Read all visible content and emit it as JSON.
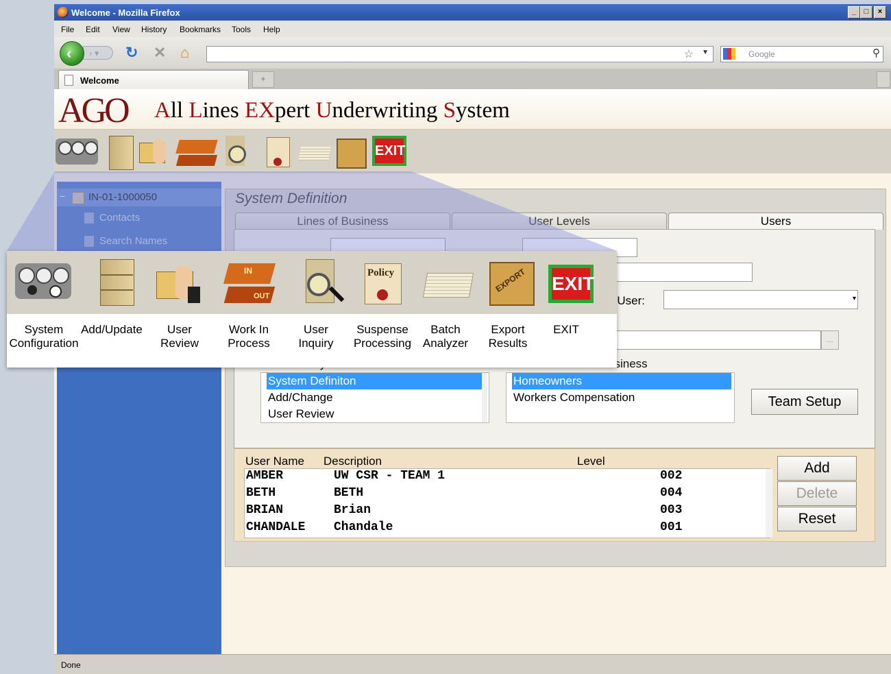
{
  "browser": {
    "window_title": "Welcome - Mozilla Firefox",
    "menu": [
      "File",
      "Edit",
      "View",
      "History",
      "Bookmarks",
      "Tools",
      "Help"
    ],
    "search_placeholder": "Google",
    "tab_title": "Welcome",
    "status": "Done"
  },
  "app": {
    "logo": "AGO",
    "title_parts": [
      {
        "cap": "A",
        "rest": "ll "
      },
      {
        "cap": "L",
        "rest": "ines "
      },
      {
        "cap": "EX",
        "rest": "pert "
      },
      {
        "cap": "U",
        "rest": "nderwriting "
      },
      {
        "cap": "S",
        "rest": "ystem"
      }
    ]
  },
  "toolbar": {
    "items": [
      {
        "line1": "System",
        "line2": "Configuration",
        "icon": "gauges-icon"
      },
      {
        "line1": "Add/Update",
        "line2": "",
        "icon": "file-cabinet-icon"
      },
      {
        "line1": "User",
        "line2": "Review",
        "icon": "thumbs-up-icon"
      },
      {
        "line1": "Work In",
        "line2": "Process",
        "icon": "in-out-tray-icon"
      },
      {
        "line1": "User",
        "line2": "Inquiry",
        "icon": "magnifier-icon"
      },
      {
        "line1": "Suspense",
        "line2": "Processing",
        "icon": "policy-scroll-icon"
      },
      {
        "line1": "Batch",
        "line2": "Analyzer",
        "icon": "paper-stack-icon"
      },
      {
        "line1": "Export",
        "line2": "Results",
        "icon": "export-crate-icon"
      },
      {
        "line1": "EXIT",
        "line2": "",
        "icon": "exit-sign-icon"
      }
    ],
    "policy_text": "Policy",
    "in_text": "IN",
    "out_text": "OUT",
    "export_text": "EXPORT",
    "exit_text": "EXIT"
  },
  "tree": {
    "root": "IN-01-1000050",
    "children": [
      "Contacts",
      "Search Names"
    ]
  },
  "panel": {
    "title": "System Definition",
    "tabs": [
      "Lines of Business",
      "User Levels",
      "Users"
    ],
    "active_tab": "Users",
    "user_label": "r User:",
    "browse_label": "...",
    "system_functions_label": "Available System Functions",
    "system_functions": [
      "System Definiton",
      "Add/Change",
      "User Review"
    ],
    "lines_label": "Available Lines of Business",
    "lines_of_business": [
      "Homeowners",
      "Workers Compensation"
    ],
    "team_setup": "Team Setup"
  },
  "users": {
    "columns": [
      "User Name",
      "Description",
      "Level"
    ],
    "rows": [
      {
        "name": "AMBER",
        "desc": "UW CSR - TEAM 1",
        "level": "002"
      },
      {
        "name": "BETH",
        "desc": "BETH",
        "level": "004"
      },
      {
        "name": "BRIAN",
        "desc": "Brian",
        "level": "003"
      },
      {
        "name": "CHANDALE",
        "desc": "Chandale",
        "level": "001"
      }
    ],
    "buttons": [
      "Add",
      "Delete",
      "Reset"
    ]
  },
  "colors": {
    "titlebar": "#2c52a7",
    "brand_red": "#9a1212",
    "tree_blue": "#3e6ec0",
    "selection": "#3399ff",
    "exit_green": "#2aa836",
    "exit_red": "#d81c1c"
  }
}
